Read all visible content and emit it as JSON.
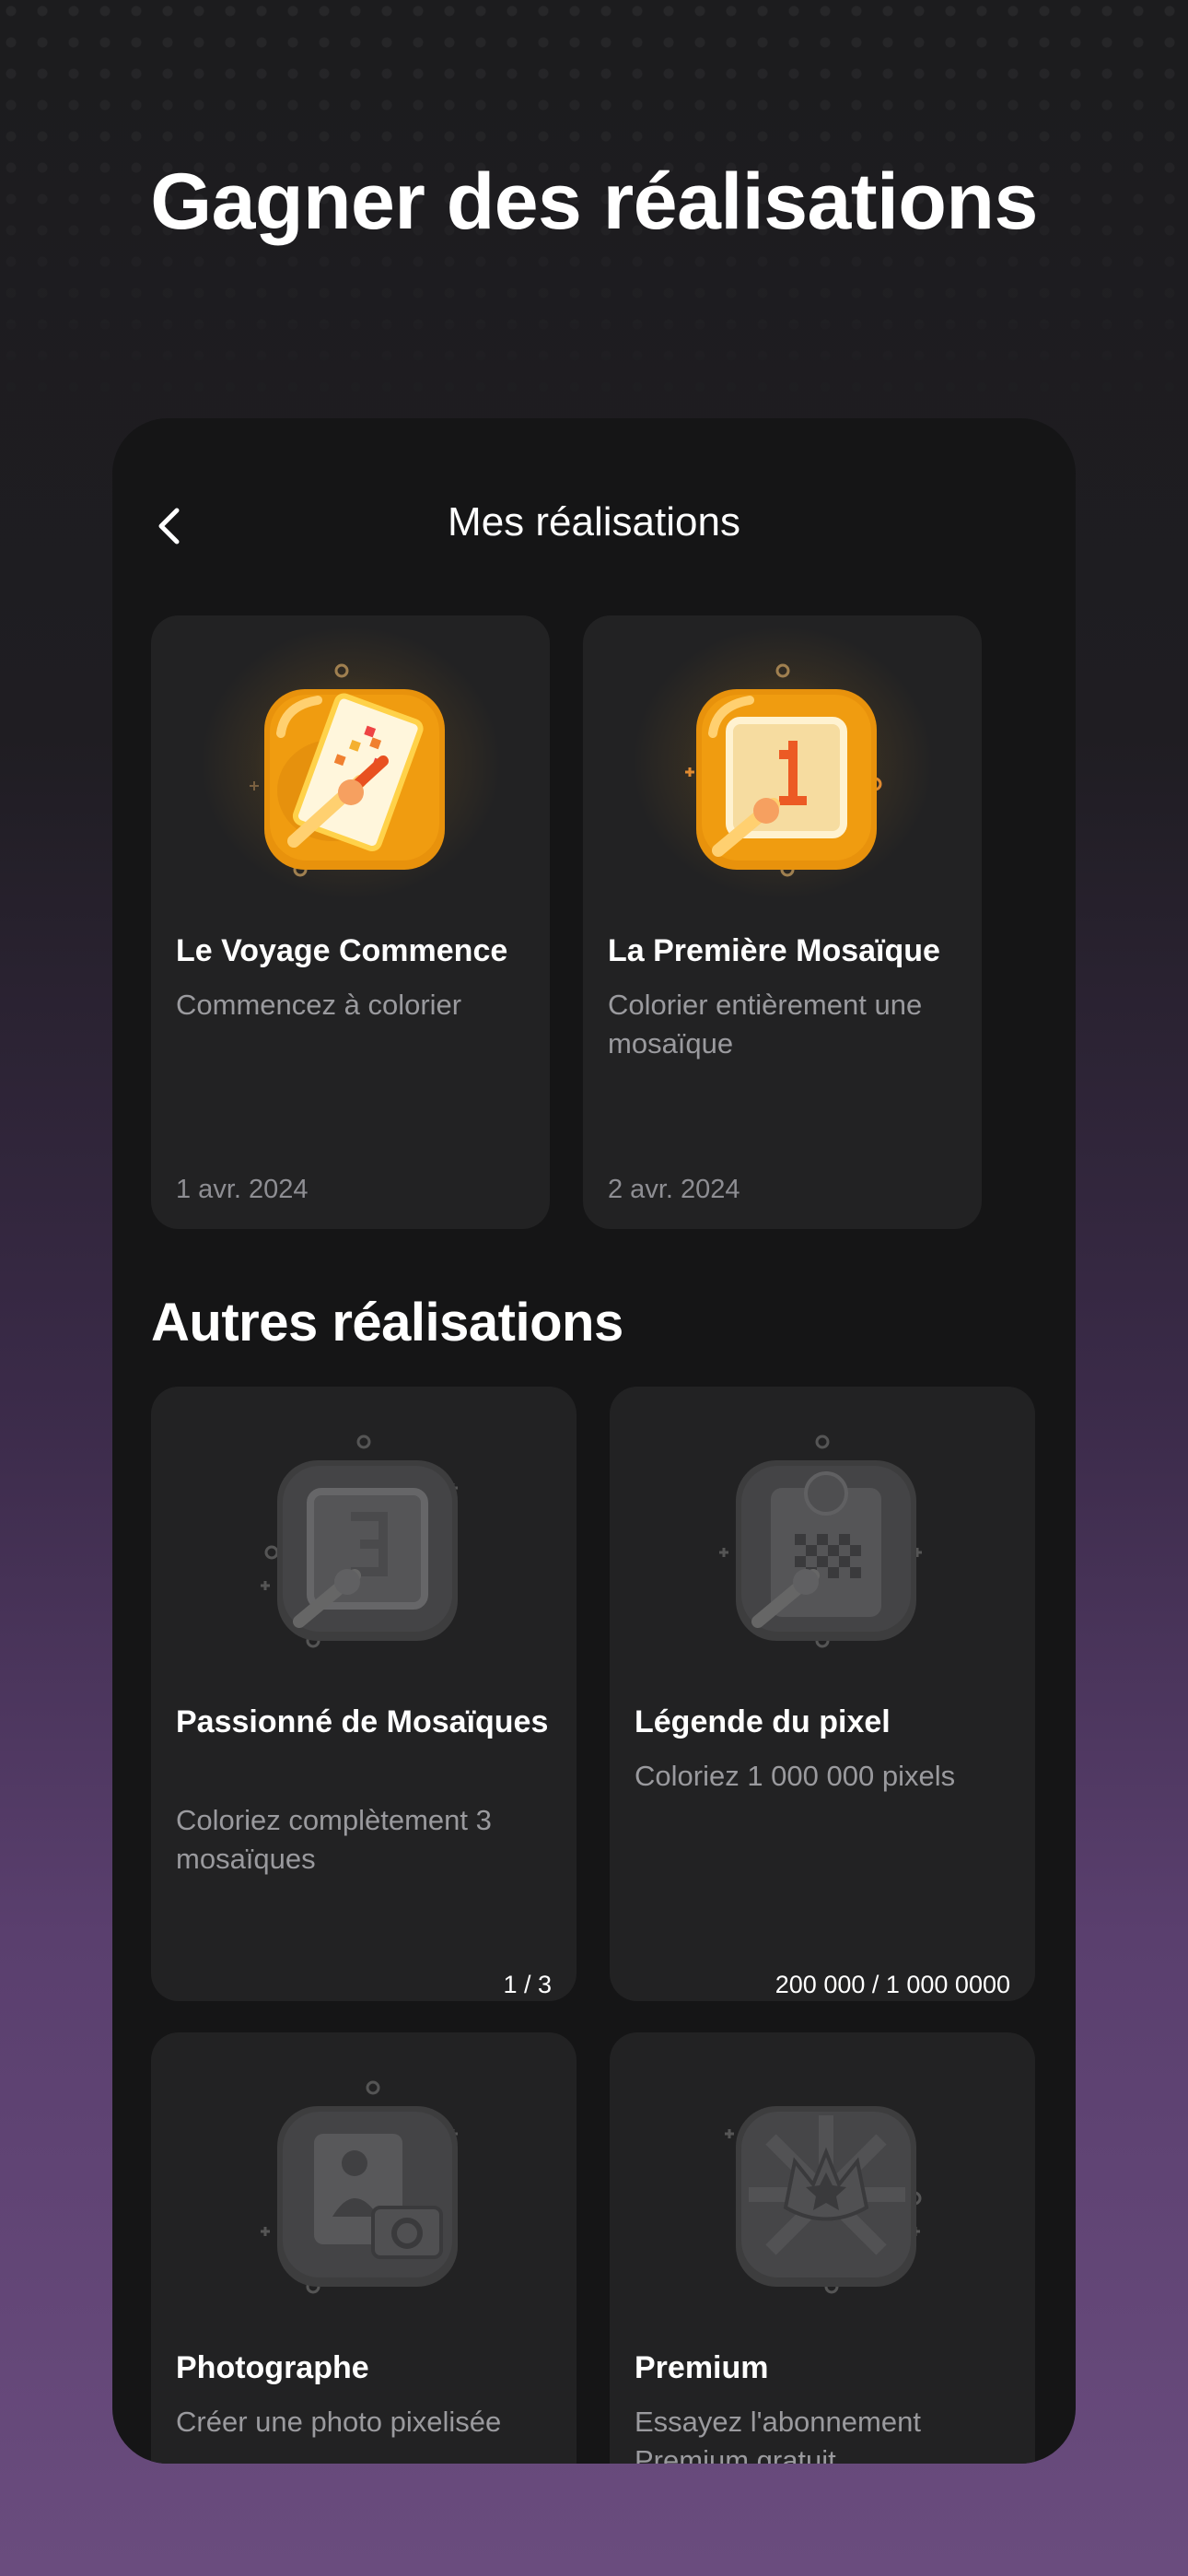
{
  "headline": "Gagner des réalisations",
  "screen": {
    "title": "Mes réalisations",
    "back_icon": "chevron-left-icon"
  },
  "earned": [
    {
      "title": "Le Voyage Commence",
      "description": "Commencez à colorier",
      "date": "1 avr. 2024",
      "icon": "brush-card-icon"
    },
    {
      "title": "La Première Mosaïque",
      "description": "Colorier entièrement une mosaïque",
      "date": "2 avr. 2024",
      "icon": "mosaic-one-icon"
    }
  ],
  "other_section_title": "Autres réalisations",
  "other": [
    {
      "title": "Passionné de Mosaïques",
      "description": "Coloriez complètement 3 mosaïques",
      "progress_text": "1 / 3",
      "progress": 0.333,
      "icon": "mosaic-three-icon"
    },
    {
      "title": "Légende du pixel",
      "description": "Coloriez 1 000 000 pixels",
      "progress_text": "200 000 / 1 000 0000",
      "progress": 0.24,
      "icon": "pixel-badge-icon"
    },
    {
      "title": "Photographe",
      "description": "Créer une photo pixelisée",
      "icon": "camera-photo-icon"
    },
    {
      "title": "Premium",
      "description": "Essayez l'abonnement Premium gratuit",
      "icon": "crown-star-icon"
    }
  ],
  "colors": {
    "accent": "#f4a21b",
    "card_bg": "#222223",
    "screen_bg": "#151516",
    "muted_text": "#9a9a9e"
  }
}
